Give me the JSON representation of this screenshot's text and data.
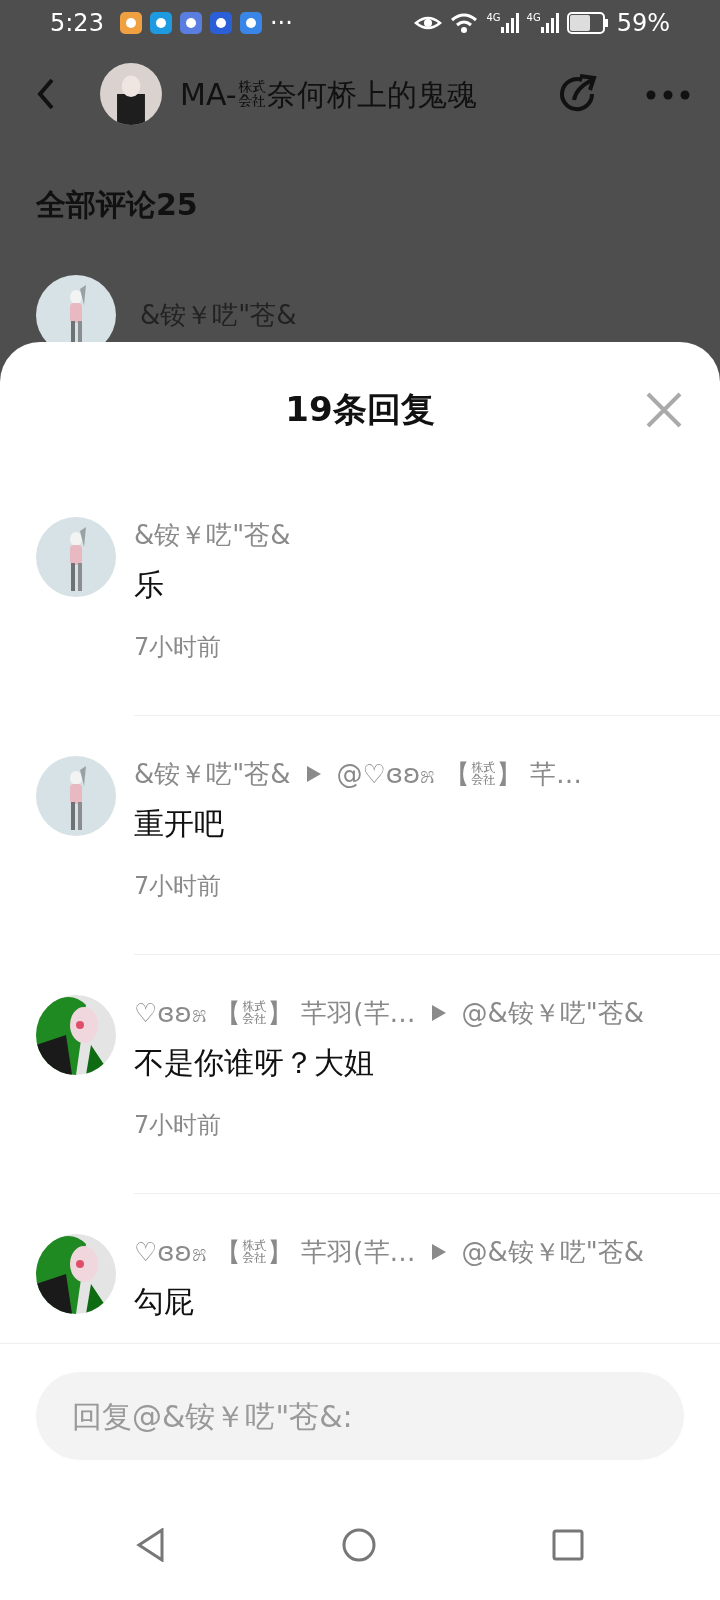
{
  "status_bar": {
    "time": "5:23",
    "more": "···",
    "signal_labels": [
      "4G",
      "4G"
    ],
    "battery": "59%"
  },
  "header": {
    "title": "MA-㍿奈何桥上的鬼魂"
  },
  "section_title": "全部评论25",
  "background_comment": {
    "author": "&铵￥呓\"苍&"
  },
  "sheet": {
    "title": "19条回复"
  },
  "replies": [
    {
      "author": "&铵￥呓\"苍&",
      "text": "乐",
      "time": "7小时前"
    },
    {
      "author": "&铵￥呓\"苍&",
      "reply_to": "@♡ɞʚ೫ 【㍿】 芊…",
      "text": "重开吧",
      "time": "7小时前"
    },
    {
      "author": "♡ɞʚ೫ 【㍿】 芊羽(芊…",
      "reply_to": "@&铵￥呓\"苍&",
      "text": "不是你谁呀？大姐",
      "time": "7小时前"
    },
    {
      "author": "♡ɞʚ೫ 【㍿】 芊羽(芊…",
      "reply_to": "@&铵￥呓\"苍&",
      "text": "勾屁"
    }
  ],
  "reply_field": {
    "placeholder": "回复@&铵￥呓\"苍&:"
  }
}
